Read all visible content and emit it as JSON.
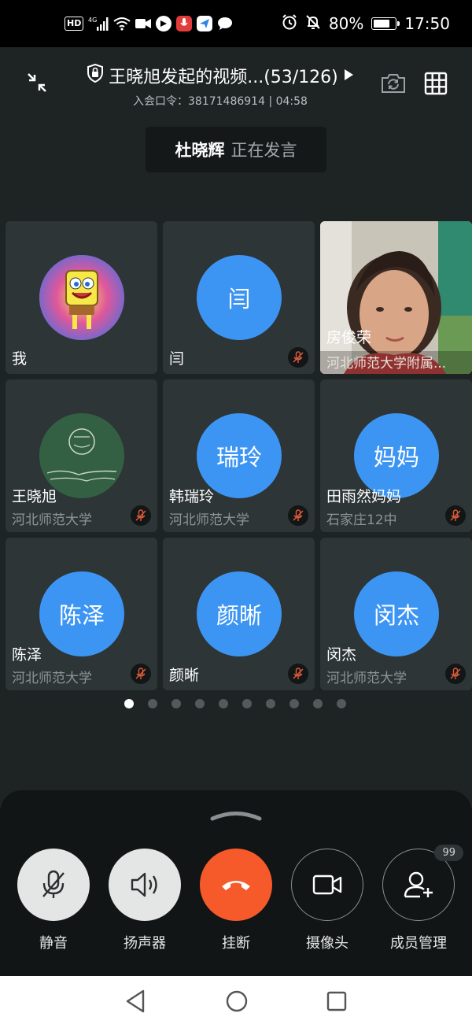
{
  "status_bar": {
    "hd": "HD",
    "network": "4G",
    "battery": "80%",
    "time": "17:50",
    "icons": [
      "hd-icon",
      "signal-icon",
      "wifi-icon",
      "video-icon",
      "app-icon",
      "mic-app-icon",
      "app-icon-2",
      "chat-icon",
      "alarm-icon",
      "mute-icon",
      "battery-icon"
    ]
  },
  "meeting": {
    "title": "王晓旭发起的视频...(53/126)",
    "subtitle": "入会口令：38171486914 | 04:58"
  },
  "speaker": {
    "name": "杜晓辉",
    "status": "正在发言"
  },
  "participants": [
    {
      "name": "我",
      "org": "",
      "avatar": "spongebob",
      "avatar_text": ""
    },
    {
      "name": "闫",
      "org": "",
      "avatar": "initial",
      "avatar_text": "闫"
    },
    {
      "name": "房俊荣",
      "org": "河北师范大学附属...",
      "avatar": "video",
      "avatar_text": ""
    },
    {
      "name": "王晓旭",
      "org": "河北师范大学",
      "avatar": "chalkboard",
      "avatar_text": ""
    },
    {
      "name": "韩瑞玲",
      "org": "河北师范大学",
      "avatar": "initial",
      "avatar_text": "瑞玲"
    },
    {
      "name": "田雨然妈妈",
      "org": "石家庄12中",
      "avatar": "initial",
      "avatar_text": "妈妈"
    },
    {
      "name": "陈泽",
      "org": "河北师范大学",
      "avatar": "initial",
      "avatar_text": "陈泽"
    },
    {
      "name": "颜晰",
      "org": "",
      "avatar": "initial",
      "avatar_text": "颜晰"
    },
    {
      "name": "闵杰",
      "org": "河北师范大学",
      "avatar": "initial",
      "avatar_text": "闵杰"
    }
  ],
  "pagination": {
    "total": 10,
    "current": 1
  },
  "controls": {
    "mute": "静音",
    "speaker": "扬声器",
    "hangup": "挂断",
    "camera": "摄像头",
    "members": "成员管理",
    "members_badge": "99"
  },
  "colors": {
    "avatar_blue": "#3d95f3",
    "hangup": "#f65a2a",
    "background": "#1e2324"
  }
}
